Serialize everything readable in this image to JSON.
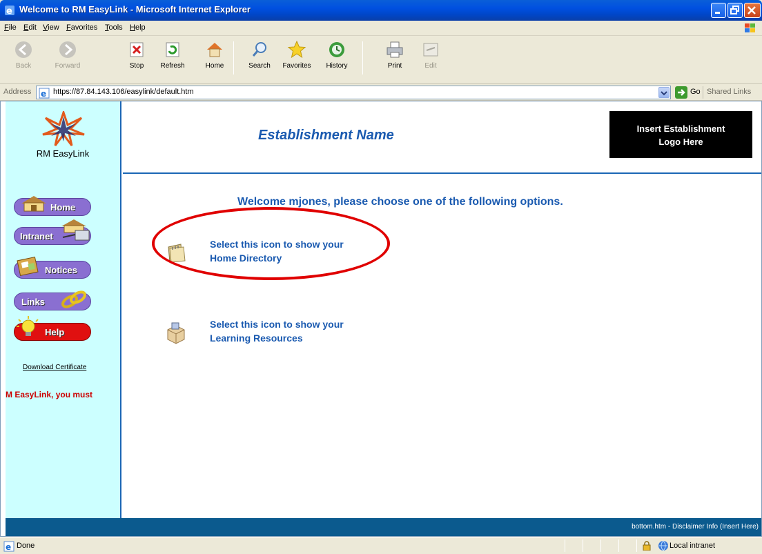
{
  "window": {
    "title": "Welcome to RM EasyLink - Microsoft Internet Explorer"
  },
  "menu": [
    "File",
    "Edit",
    "View",
    "Favorites",
    "Tools",
    "Help"
  ],
  "toolbar": {
    "back": "Back",
    "forward": "Forward",
    "stop": "Stop",
    "refresh": "Refresh",
    "home": "Home",
    "search": "Search",
    "favorites": "Favorites",
    "history": "History",
    "print": "Print",
    "edit": "Edit"
  },
  "address": {
    "label": "Address",
    "url": "https://87.84.143.106/easylink/default.htm",
    "go": "Go",
    "links": "Shared Links"
  },
  "sidebar": {
    "brand": "RM EasyLink",
    "nav": [
      "Home",
      "Intranet",
      "Notices",
      "Links",
      "Help"
    ],
    "download": "Download Certificate",
    "marquee": "M EasyLink, you must"
  },
  "header": {
    "establishment": "Establishment Name",
    "logo_line1": "Insert Establishment",
    "logo_line2": "Logo Here"
  },
  "main": {
    "welcome": "Welcome mjones, please choose one of the following options.",
    "options": [
      {
        "line1": "Select this icon to show your",
        "line2": "Home Directory"
      },
      {
        "line1": "Select this icon to show your",
        "line2": "Learning Resources"
      }
    ]
  },
  "footer": {
    "text": "bottom.htm - Disclaimer Info (Insert Here)"
  },
  "status": {
    "text": "Done",
    "zone": "Local intranet"
  },
  "colors": {
    "heading_blue": "#1a5ab0",
    "sidebar_bg": "#ccffff",
    "footer_bg": "#0b5a8e",
    "highlight_red": "#e00000",
    "marquee_red": "#cc0000"
  }
}
